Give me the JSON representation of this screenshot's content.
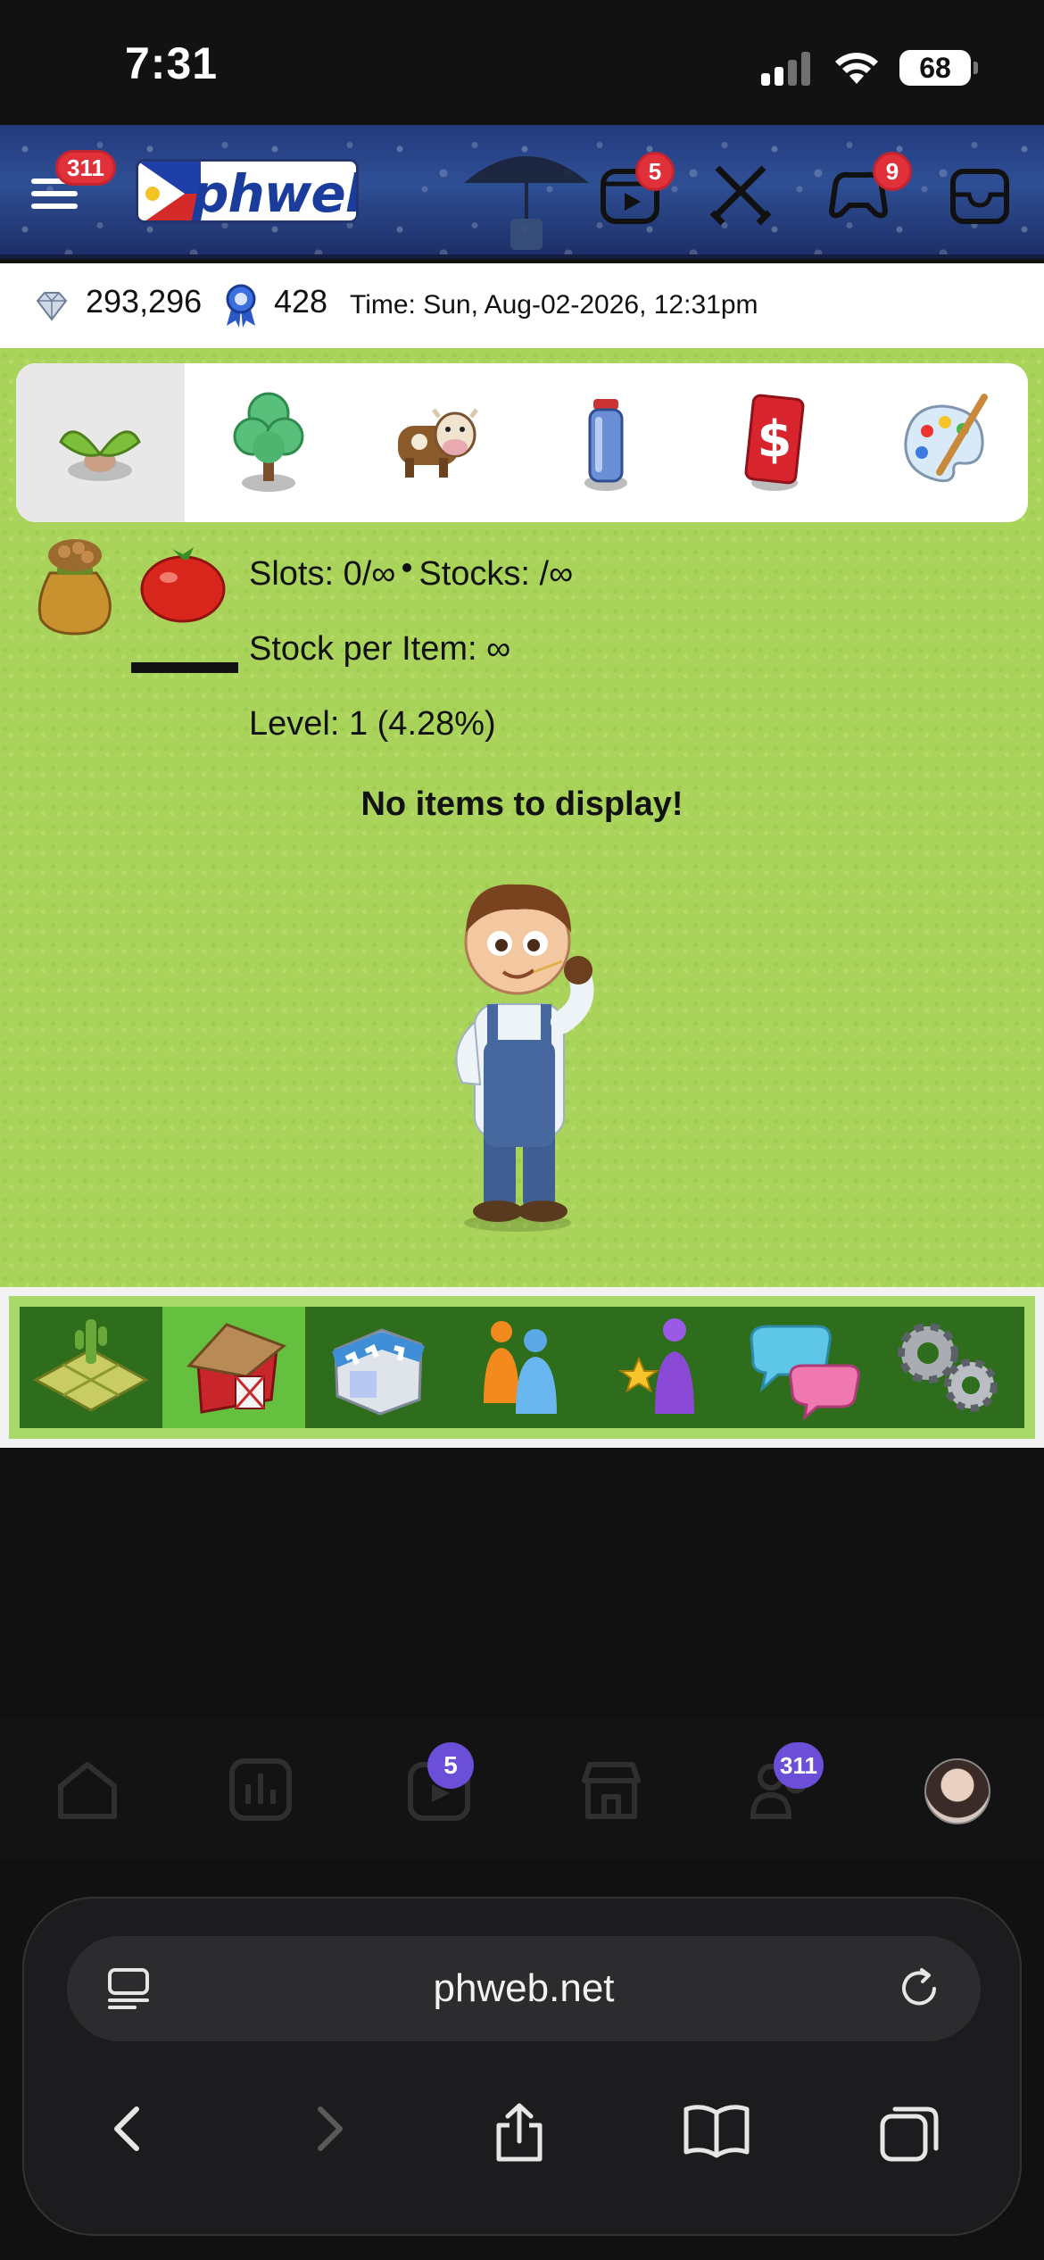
{
  "status_bar": {
    "time": "7:31",
    "battery": "68"
  },
  "header": {
    "menu_badge": "311",
    "logo_text": "phweb",
    "reels_badge": "5",
    "games_badge": "9"
  },
  "info": {
    "gems": "293,296",
    "ribbons": "428",
    "time": "Time: Sun, Aug-02-2026, 12:31pm"
  },
  "categories": [
    "sprout-icon",
    "tree-icon",
    "cow-icon",
    "spray-can-icon",
    "price-tag-icon",
    "paint-palette-icon"
  ],
  "stats": {
    "slots_label": "Slots: 0/∞",
    "stocks_label": "Stocks: /∞",
    "stock_per_item": "Stock per Item: ∞",
    "level": "Level: 1 (4.28%)"
  },
  "empty_message": "No items to display!",
  "bottom_menu": [
    "farm-plot-icon",
    "barn-icon",
    "shop-icon",
    "neighbors-icon",
    "profile-star-icon",
    "chat-icon",
    "settings-gears-icon"
  ],
  "site_nav": {
    "reels_badge": "5",
    "groups_badge": "311"
  },
  "browser": {
    "url": "phweb.net"
  }
}
